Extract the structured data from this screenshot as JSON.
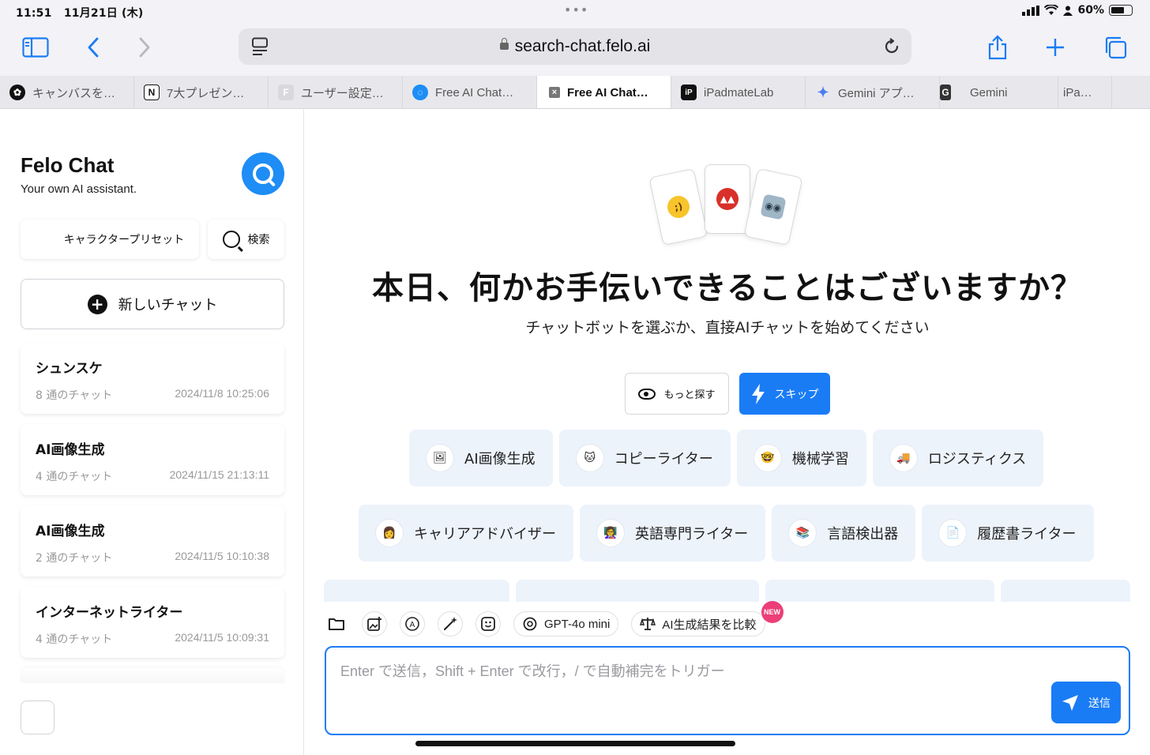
{
  "status": {
    "time": "11:51",
    "date": "11月21日 (木)",
    "battery": "60%"
  },
  "browser": {
    "url": "search-chat.felo.ai"
  },
  "tabs": [
    {
      "label": "キャンバスを…",
      "icon_color": "#111111",
      "icon_text": ""
    },
    {
      "label": "7大プレゼン…",
      "icon_color": "#ffffff",
      "icon_text": "N"
    },
    {
      "label": "ユーザー設定…",
      "icon_color": "#d9d9dd",
      "icon_text": "F"
    },
    {
      "label": "Free AI Chat…",
      "icon_color": "#1e8df5",
      "icon_text": ""
    },
    {
      "label": "Free AI Chat…",
      "icon_color": "#777777",
      "icon_text": "×"
    },
    {
      "label": "iPadmateLab",
      "icon_color": "#111111",
      "icon_text": "iP"
    },
    {
      "label": "Gemini アプ…",
      "icon_color": "#ffffff",
      "icon_text": "✦"
    },
    {
      "label": "Gemini",
      "icon_color": "#333333",
      "icon_text": "G"
    },
    {
      "label": "iPa…",
      "icon_color": "",
      "icon_text": ""
    }
  ],
  "sidebar": {
    "title": "Felo Chat",
    "subtitle": "Your own AI assistant.",
    "preset_label": "キャラクタープリセット",
    "search_label": "検索",
    "new_chat_label": "新しいチャット",
    "chats": [
      {
        "title": "シュンスケ",
        "count": "8 通のチャット",
        "date": "2024/11/8 10:25:06"
      },
      {
        "title": "AI画像生成",
        "count": "4 通のチャット",
        "date": "2024/11/15 21:13:11"
      },
      {
        "title": "AI画像生成",
        "count": "2 通のチャット",
        "date": "2024/11/5 10:10:38"
      },
      {
        "title": "インターネットライター",
        "count": "4 通のチャット",
        "date": "2024/11/5 10:09:31"
      }
    ]
  },
  "main": {
    "headline": "本日、何かお手伝いできることはございますか？",
    "subline": "チャットボットを選ぶか、直接AIチャットを始めてください",
    "explore_label": "もっと探す",
    "skip_label": "スキップ",
    "bots_row1": [
      {
        "label": "AI画像生成",
        "icon": "🖼"
      },
      {
        "label": "コピーライター",
        "icon": "🐱"
      },
      {
        "label": "機械学習",
        "icon": "🤓"
      },
      {
        "label": "ロジスティクス",
        "icon": "🚚"
      }
    ],
    "bots_row2": [
      {
        "label": "キャリアアドバイザー",
        "icon": "👩"
      },
      {
        "label": "英語専門ライター",
        "icon": "👩‍🏫"
      },
      {
        "label": "言語検出器",
        "icon": "📚"
      },
      {
        "label": "履歴書ライター",
        "icon": "📄"
      }
    ]
  },
  "composer": {
    "model_label": "GPT-4o mini",
    "compare_label": "AI生成結果を比較",
    "new_badge": "NEW",
    "placeholder": "Enter で送信，Shift + Enter で改行，/ で自動補完をトリガー",
    "send_label": "送信"
  },
  "colors": {
    "accent": "#1a7cf5",
    "chip_bg": "#edf3fb",
    "badge": "#ec3f78"
  }
}
